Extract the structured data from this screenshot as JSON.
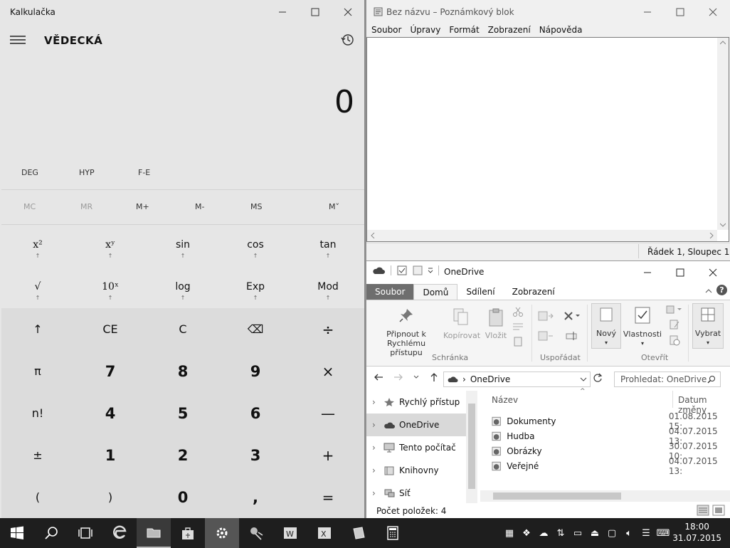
{
  "calculator": {
    "title": "Kalkulačka",
    "mode": "VĚDECKÁ",
    "display": "0",
    "toggles": [
      "DEG",
      "HYP",
      "F-E"
    ],
    "memory": [
      "MC",
      "MR",
      "M+",
      "M-",
      "MS",
      "M˅"
    ],
    "sci_row1": [
      "x²",
      "xʸ",
      "sin",
      "cos",
      "tan"
    ],
    "sci_row2": [
      "√",
      "10ˣ",
      "log",
      "Exp",
      "Mod"
    ],
    "arrow": "↑",
    "keys": [
      [
        "↑",
        "CE",
        "C",
        "⌫",
        "÷"
      ],
      [
        "π",
        "7",
        "8",
        "9",
        "×"
      ],
      [
        "n!",
        "4",
        "5",
        "6",
        "—"
      ],
      [
        "±",
        "1",
        "2",
        "3",
        "+"
      ],
      [
        "(",
        ")",
        "0",
        ",",
        "="
      ]
    ]
  },
  "notepad": {
    "title": "Bez názvu – Poznámkový blok",
    "menu": [
      "Soubor",
      "Úpravy",
      "Formát",
      "Zobrazení",
      "Nápověda"
    ],
    "status": "Řádek 1, Sloupec 1"
  },
  "explorer": {
    "title": "OneDrive",
    "tabs": [
      "Soubor",
      "Domů",
      "Sdílení",
      "Zobrazení"
    ],
    "ribbon": {
      "pin": "Připnout k Rychlému přístupu",
      "copy": "Kopírovat",
      "paste": "Vložit",
      "clipboard_group": "Schránka",
      "organize_group": "Uspořádat",
      "new": "Nový",
      "properties": "Vlastnosti",
      "open_group": "Otevřít",
      "select": "Vybrat"
    },
    "address": "OneDrive",
    "search_placeholder": "Prohledat: OneDrive",
    "nav": [
      "Rychlý přístup",
      "OneDrive",
      "Tento počítač",
      "Knihovny",
      "Síť"
    ],
    "columns": {
      "name": "Název",
      "date": "Datum změny"
    },
    "files": [
      {
        "name": "Dokumenty",
        "date": "01.08.2015 15:"
      },
      {
        "name": "Hudba",
        "date": "04.07.2015 13:"
      },
      {
        "name": "Obrázky",
        "date": "30.07.2015 10:"
      },
      {
        "name": "Veřejné",
        "date": "04.07.2015 13:"
      }
    ],
    "status": "Počet položek: 4"
  },
  "taskbar": {
    "time": "18:00",
    "date": "31.07.2015",
    "tray_icons": [
      "keyboard-layout-icon",
      "dropbox-icon",
      "onedrive-icon",
      "network-icon",
      "battery-icon",
      "usb-icon",
      "display-icon",
      "volume-icon",
      "action-center-icon",
      "keyboard-icon"
    ]
  }
}
